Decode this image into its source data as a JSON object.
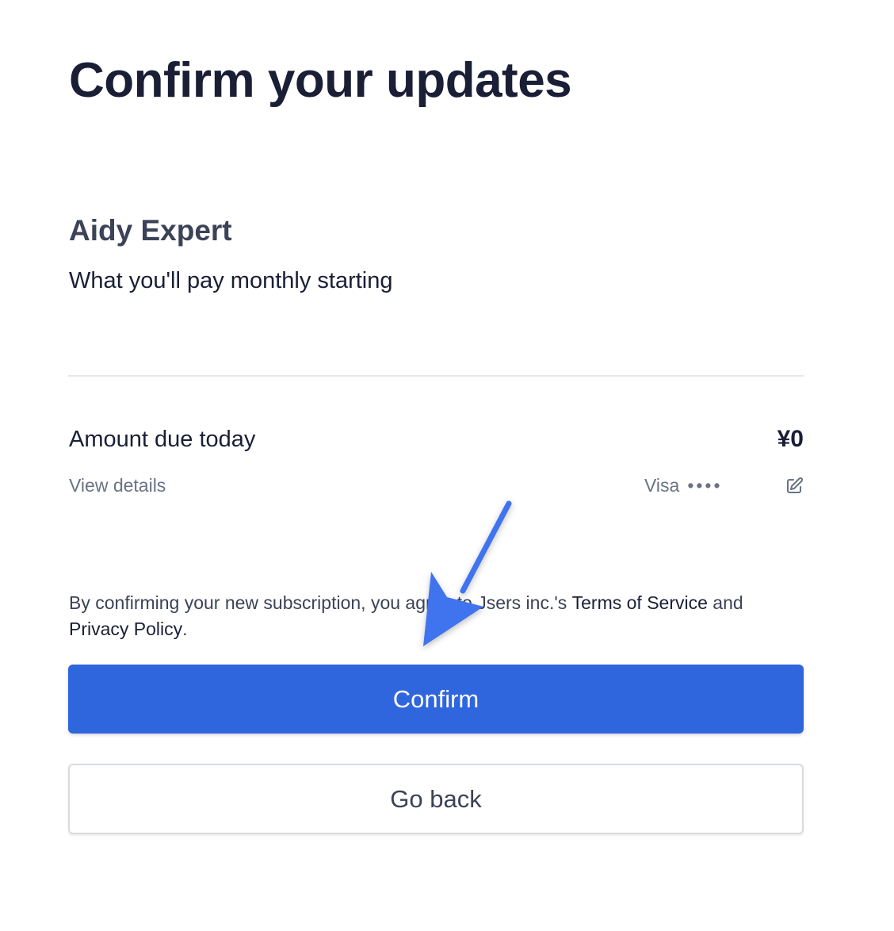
{
  "page": {
    "title": "Confirm your updates"
  },
  "plan": {
    "name": "Aidy Expert",
    "description": "What you'll pay monthly starting"
  },
  "summary": {
    "amount_label": "Amount due today",
    "amount_value": "¥0",
    "view_details_label": "View details",
    "card_brand": "Visa",
    "card_masked": "••••",
    "edit_icon": "edit-icon"
  },
  "terms": {
    "prefix": "By confirming your new subscription, you agree to Jsers inc.'s ",
    "terms_link": "Terms of Service",
    "middle": " and ",
    "privacy_link": "Privacy Policy",
    "suffix": "."
  },
  "buttons": {
    "confirm_label": "Confirm",
    "back_label": "Go back"
  },
  "colors": {
    "primary": "#2f66dd",
    "annotation_arrow": "#3f73ee",
    "text_dark": "#1a1f36",
    "text_muted": "#697386"
  }
}
